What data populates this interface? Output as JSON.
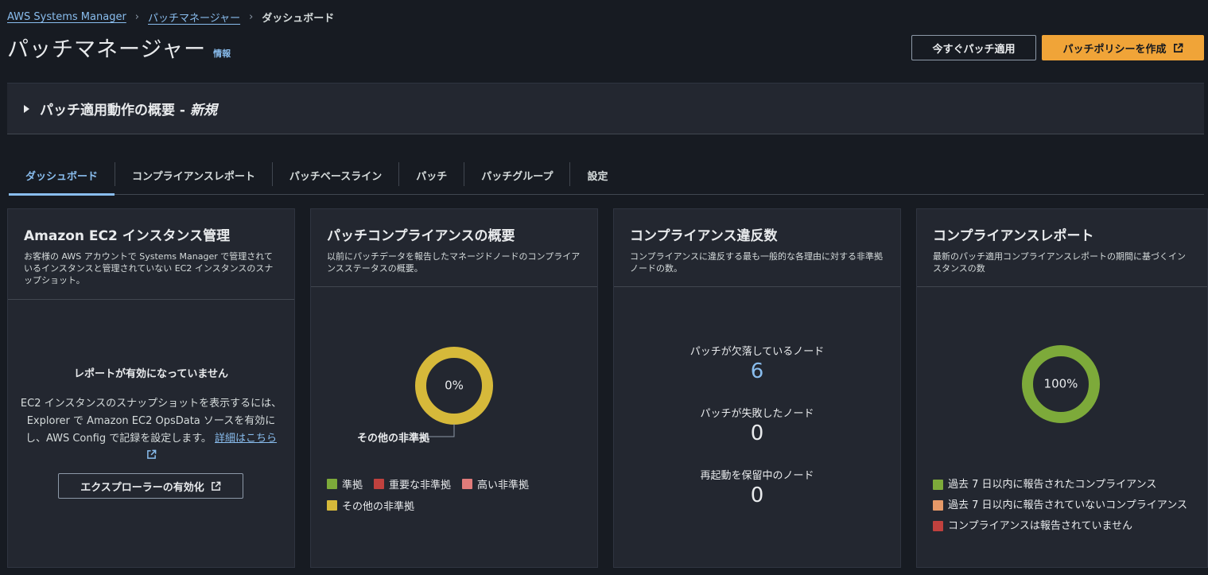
{
  "breadcrumb": {
    "items": [
      "AWS Systems Manager",
      "パッチマネージャー"
    ],
    "current": "ダッシュボード"
  },
  "header": {
    "title": "パッチマネージャー",
    "info": "情報",
    "apply_now": "今すぐパッチ適用",
    "create_policy": "パッチポリシーを作成"
  },
  "overview": {
    "title": "パッチ適用動作の概要 - ",
    "badge": "新規"
  },
  "tabs": [
    {
      "label": "ダッシュボード",
      "active": true
    },
    {
      "label": "コンプライアンスレポート"
    },
    {
      "label": "パッチベースライン"
    },
    {
      "label": "パッチ"
    },
    {
      "label": "パッチグループ"
    },
    {
      "label": "設定"
    }
  ],
  "cards": {
    "ec2": {
      "title": "Amazon EC2 インスタンス管理",
      "desc": "お客様の AWS アカウントで Systems Manager で管理されているインスタンスと管理されていない EC2 インスタンスのスナップショット。",
      "empty_title": "レポートが有効になっていません",
      "empty_desc": "EC2 インスタンスのスナップショットを表示するには、Explorer で Amazon EC2 OpsData ソースを有効にし、AWS Config で記録を設定します。",
      "link": "詳細はこちら",
      "button": "エクスプローラーの有効化"
    },
    "patch_summary": {
      "title": "パッチコンプライアンスの概要",
      "desc": "以前にパッチデータを報告したマネージドノードのコンプライアンスステータスの概要。",
      "donut_label": "0%",
      "callout": "その他の非準拠",
      "legend": [
        {
          "label": "準拠",
          "color": "#7daa3a"
        },
        {
          "label": "重要な非準拠",
          "color": "#c0413e"
        },
        {
          "label": "高い非準拠",
          "color": "#e07b7a"
        },
        {
          "label": "その他の非準拠",
          "color": "#d6b93a"
        }
      ]
    },
    "violations": {
      "title": "コンプライアンス違反数",
      "desc": "コンプライアンスに違反する最も一般的な各理由に対する非準拠ノードの数。",
      "stats": [
        {
          "label": "パッチが欠落しているノード",
          "value": "6"
        },
        {
          "label": "パッチが失敗したノード",
          "value": "0"
        },
        {
          "label": "再起動を保留中のノード",
          "value": "0"
        }
      ]
    },
    "report": {
      "title": "コンプライアンスレポート",
      "desc": "最新のパッチ適用コンプライアンスレポートの期間に基づくインスタンスの数",
      "donut_label": "100%",
      "legend": [
        {
          "label": "過去 7 日以内に報告されたコンプライアンス",
          "color": "#7daa3a"
        },
        {
          "label": "過去 7 日以内に報告されていないコンプライアンス",
          "color": "#e69968"
        },
        {
          "label": "コンプライアンスは報告されていません",
          "color": "#c0413e"
        }
      ]
    }
  },
  "chart_data": [
    {
      "type": "pie",
      "categories": [
        "準拠",
        "重要な非準拠",
        "高い非準拠",
        "その他の非準拠"
      ],
      "values": [
        0,
        0,
        0,
        100
      ],
      "title": "パッチコンプライアンスの概要"
    },
    {
      "type": "pie",
      "categories": [
        "過去 7 日以内に報告されたコンプライアンス",
        "過去 7 日以内に報告されていないコンプライアンス",
        "コンプライアンスは報告されていません"
      ],
      "values": [
        100,
        0,
        0
      ],
      "title": "コンプライアンスレポート"
    }
  ]
}
